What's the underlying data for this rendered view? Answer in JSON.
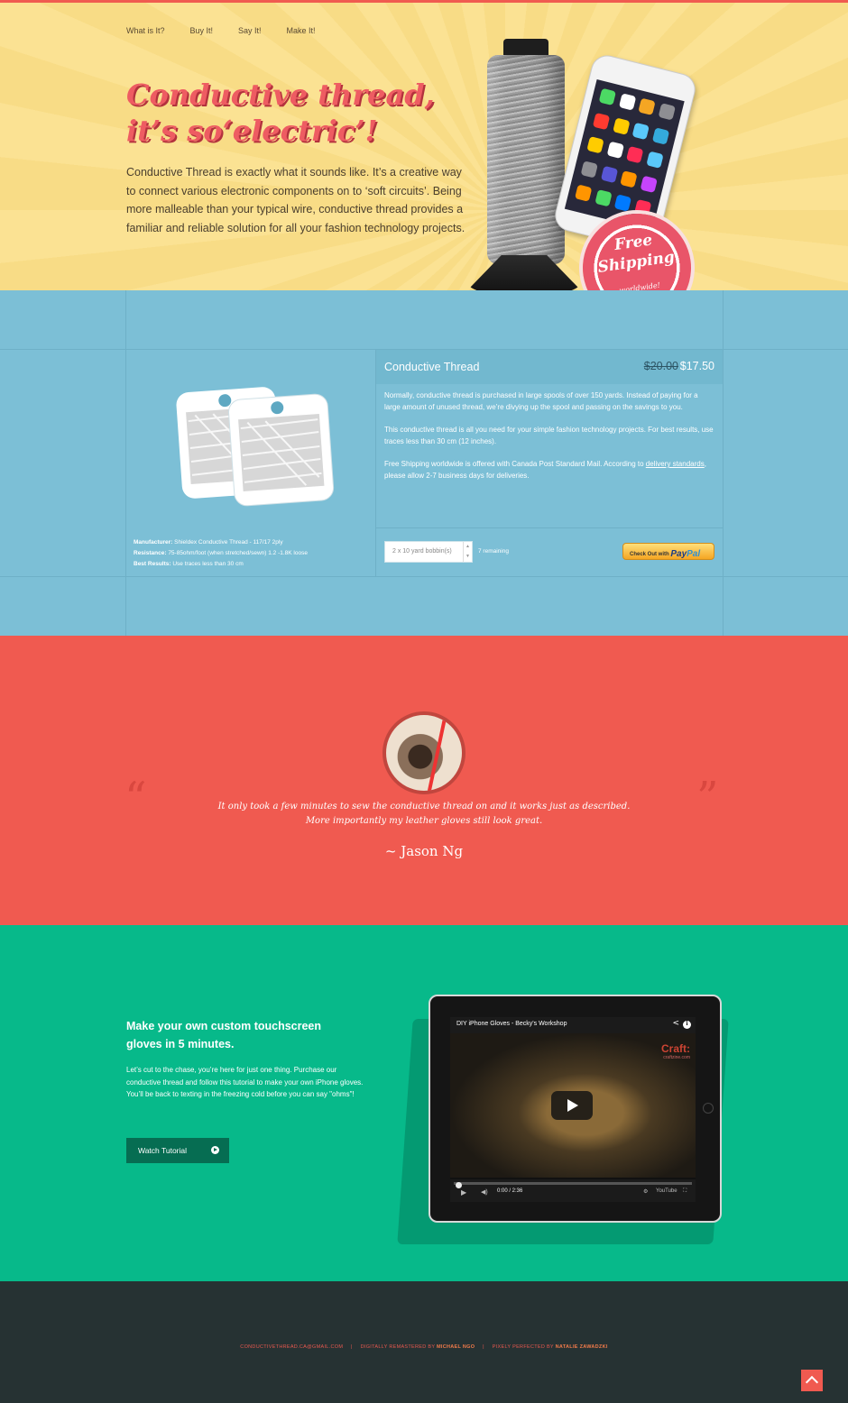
{
  "nav": [
    {
      "label": "What is It?"
    },
    {
      "label": "Buy It!"
    },
    {
      "label": "Say It!"
    },
    {
      "label": "Make It!"
    }
  ],
  "hero": {
    "title_line1": "Conductive thread,",
    "title_line2": "it’s so‘electric’!",
    "text": "Conductive Thread is exactly what it sounds like. It’s a creative way to connect various electronic components on to ‘soft circuits’. Being more malleable than your typical wire, conductive thread provides a familiar and reliable solution for all your fashion technology projects.",
    "badge": {
      "line1": "Free",
      "line2": "Shipping",
      "line3": "worldwide!"
    }
  },
  "product": {
    "name": "Conductive Thread",
    "price_old": "$20.00",
    "price_new": "$17.50",
    "desc_p1": "Normally, conductive thread is purchased in large spools of over 150 yards. Instead of paying for a large amount of unused thread, we’re divying up the spool and passing on the savings to you.",
    "desc_p2": "This conductive thread is all you need for your simple fashion technology projects. For best results, use traces less than 30 cm (12 inches).",
    "desc_p3a": "Free Shipping worldwide is offered with Canada Post Standard Mail. According to ",
    "desc_link": "delivery standards",
    "desc_p3b": ", please allow 2-7 business days for deliveries.",
    "specs": {
      "manufacturer_label": "Manufacturer:",
      "manufacturer": "Shieldex Conductive Thread - 117/17 2ply",
      "resistance_label": "Resistance:",
      "resistance": "75-85ohm/foot (when stretched/sewn) 1.2 -1.8K loose",
      "best_label": "Best Results:",
      "best": "Use traces less than 30 cm"
    },
    "quantity_value": "2 x 10 yard bobbin(s)",
    "remaining": "7 remaining",
    "paypal_prefix": "Check Out with",
    "paypal_pay": "Pay",
    "paypal_pal": "Pal"
  },
  "testimonial": {
    "quote_line1": "It only took a few minutes to sew the conductive thread on and it works just as described.",
    "quote_line2": "More importantly my leather gloves still look great.",
    "author": "~ Jason Ng"
  },
  "tutorial": {
    "title": "Make your own custom touchscreen gloves in 5 minutes.",
    "text": "Let’s cut to the chase, you’re here for just one thing. Purchase our conductive thread and follow this tutorial to make your own iPhone gloves. You’ll be back to texting in the freezing cold before you can say \"ohms\"!",
    "button": "Watch Tutorial",
    "video_title": "DIY iPhone Gloves - Becky's Workshop",
    "video_brand": "Craft:",
    "video_brand_sub": "craftzine.com",
    "video_time": "0:00 / 2:36",
    "video_logo": "YouTube"
  },
  "footer": {
    "email": "CONDUCTIVETHREAD.CA@GMAIL.COM",
    "remaster_prefix": "DIGITALLY REMASTERED BY",
    "remaster_name": "MICHAEL NGO",
    "perfect_prefix": "PIXELY PERFECTED BY",
    "perfect_name": "NATALIE ZAWADZKI",
    "separator": "|"
  },
  "colors": {
    "hero_bg": "#fbe293",
    "product_bg": "#7cbfd6",
    "testimonial_bg": "#f05a50",
    "tutorial_bg": "#07b98a",
    "footer_bg": "#263233",
    "accent": "#ee5c62"
  },
  "icons": [
    "play-icon",
    "share-icon",
    "info-icon",
    "volume-icon",
    "settings-icon",
    "fullscreen-icon",
    "back-to-top-icon",
    "quote-open-icon",
    "quote-close-icon"
  ]
}
